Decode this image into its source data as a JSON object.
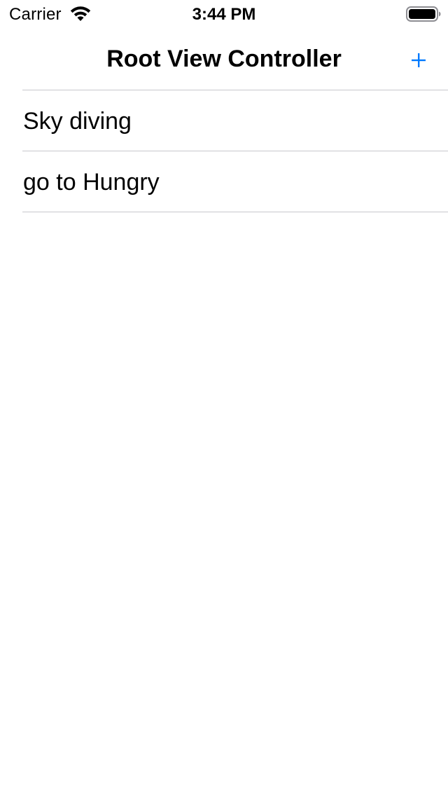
{
  "status_bar": {
    "carrier": "Carrier",
    "time": "3:44 PM",
    "wifi_icon": "wifi-icon",
    "battery_icon": "battery-icon",
    "battery_level": 1.0
  },
  "nav": {
    "title": "Root View Controller",
    "add_icon": "plus-icon",
    "add_label": "+"
  },
  "colors": {
    "accent": "#007aff",
    "separator": "#c8c7cc",
    "text": "#000000",
    "background": "#ffffff"
  },
  "list": {
    "items": [
      {
        "label": "Sky diving"
      },
      {
        "label": "go to Hungry"
      }
    ]
  }
}
